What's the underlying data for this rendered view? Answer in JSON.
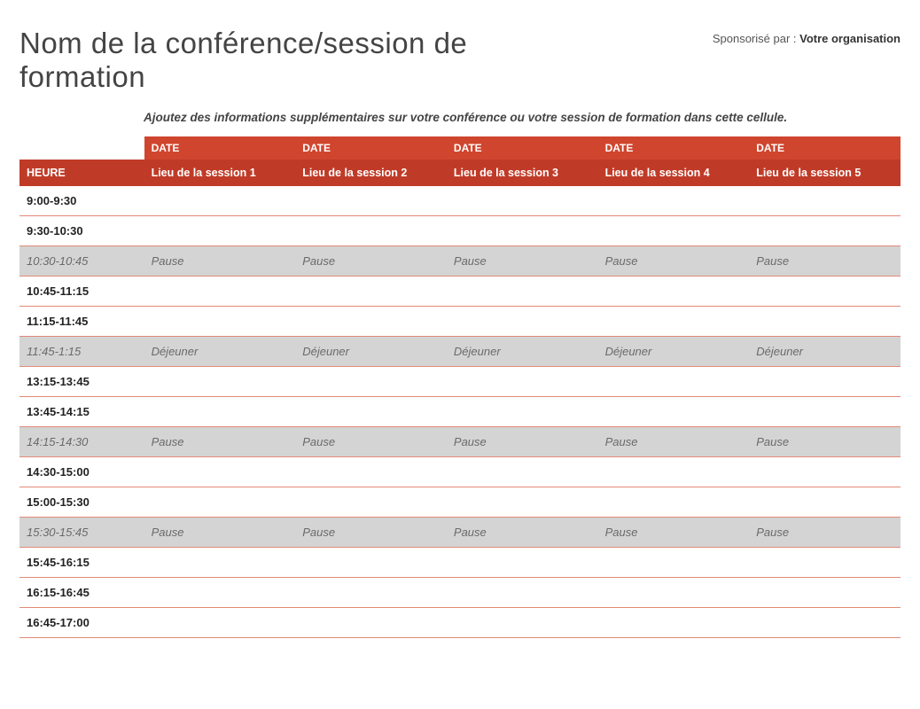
{
  "header": {
    "title": "Nom de la conférence/session de formation",
    "sponsor_label": "Sponsorisé par : ",
    "sponsor_org": "Votre organisation",
    "subtitle": "Ajoutez des informations supplémentaires sur votre conférence ou votre session de formation dans cette cellule."
  },
  "table": {
    "date_label": "DATE",
    "time_header": "HEURE",
    "sessions": [
      "Lieu de la session 1",
      "Lieu de la session 2",
      "Lieu de la session 3",
      "Lieu de la session 4",
      "Lieu de la session 5"
    ],
    "rows": [
      {
        "time": "9:00-9:30",
        "break": false,
        "cells": [
          "",
          "",
          "",
          "",
          ""
        ]
      },
      {
        "time": "9:30-10:30",
        "break": false,
        "cells": [
          "",
          "",
          "",
          "",
          ""
        ]
      },
      {
        "time": "10:30-10:45",
        "break": true,
        "cells": [
          "Pause",
          "Pause",
          "Pause",
          "Pause",
          "Pause"
        ]
      },
      {
        "time": "10:45-11:15",
        "break": false,
        "cells": [
          "",
          "",
          "",
          "",
          ""
        ]
      },
      {
        "time": "11:15-11:45",
        "break": false,
        "cells": [
          "",
          "",
          "",
          "",
          ""
        ]
      },
      {
        "time": "11:45-1:15",
        "break": true,
        "cells": [
          "Déjeuner",
          "Déjeuner",
          "Déjeuner",
          "Déjeuner",
          "Déjeuner"
        ]
      },
      {
        "time": "13:15-13:45",
        "break": false,
        "cells": [
          "",
          "",
          "",
          "",
          ""
        ]
      },
      {
        "time": "13:45-14:15",
        "break": false,
        "cells": [
          "",
          "",
          "",
          "",
          ""
        ]
      },
      {
        "time": "14:15-14:30",
        "break": true,
        "cells": [
          "Pause",
          "Pause",
          "Pause",
          "Pause",
          "Pause"
        ]
      },
      {
        "time": "14:30-15:00",
        "break": false,
        "cells": [
          "",
          "",
          "",
          "",
          ""
        ]
      },
      {
        "time": "15:00-15:30",
        "break": false,
        "cells": [
          "",
          "",
          "",
          "",
          ""
        ]
      },
      {
        "time": "15:30-15:45",
        "break": true,
        "cells": [
          "Pause",
          "Pause",
          "Pause",
          "Pause",
          "Pause"
        ]
      },
      {
        "time": "15:45-16:15",
        "break": false,
        "cells": [
          "",
          "",
          "",
          "",
          ""
        ]
      },
      {
        "time": "16:15-16:45",
        "break": false,
        "cells": [
          "",
          "",
          "",
          "",
          ""
        ]
      },
      {
        "time": "16:45-17:00",
        "break": false,
        "cells": [
          "",
          "",
          "",
          "",
          ""
        ]
      }
    ]
  }
}
